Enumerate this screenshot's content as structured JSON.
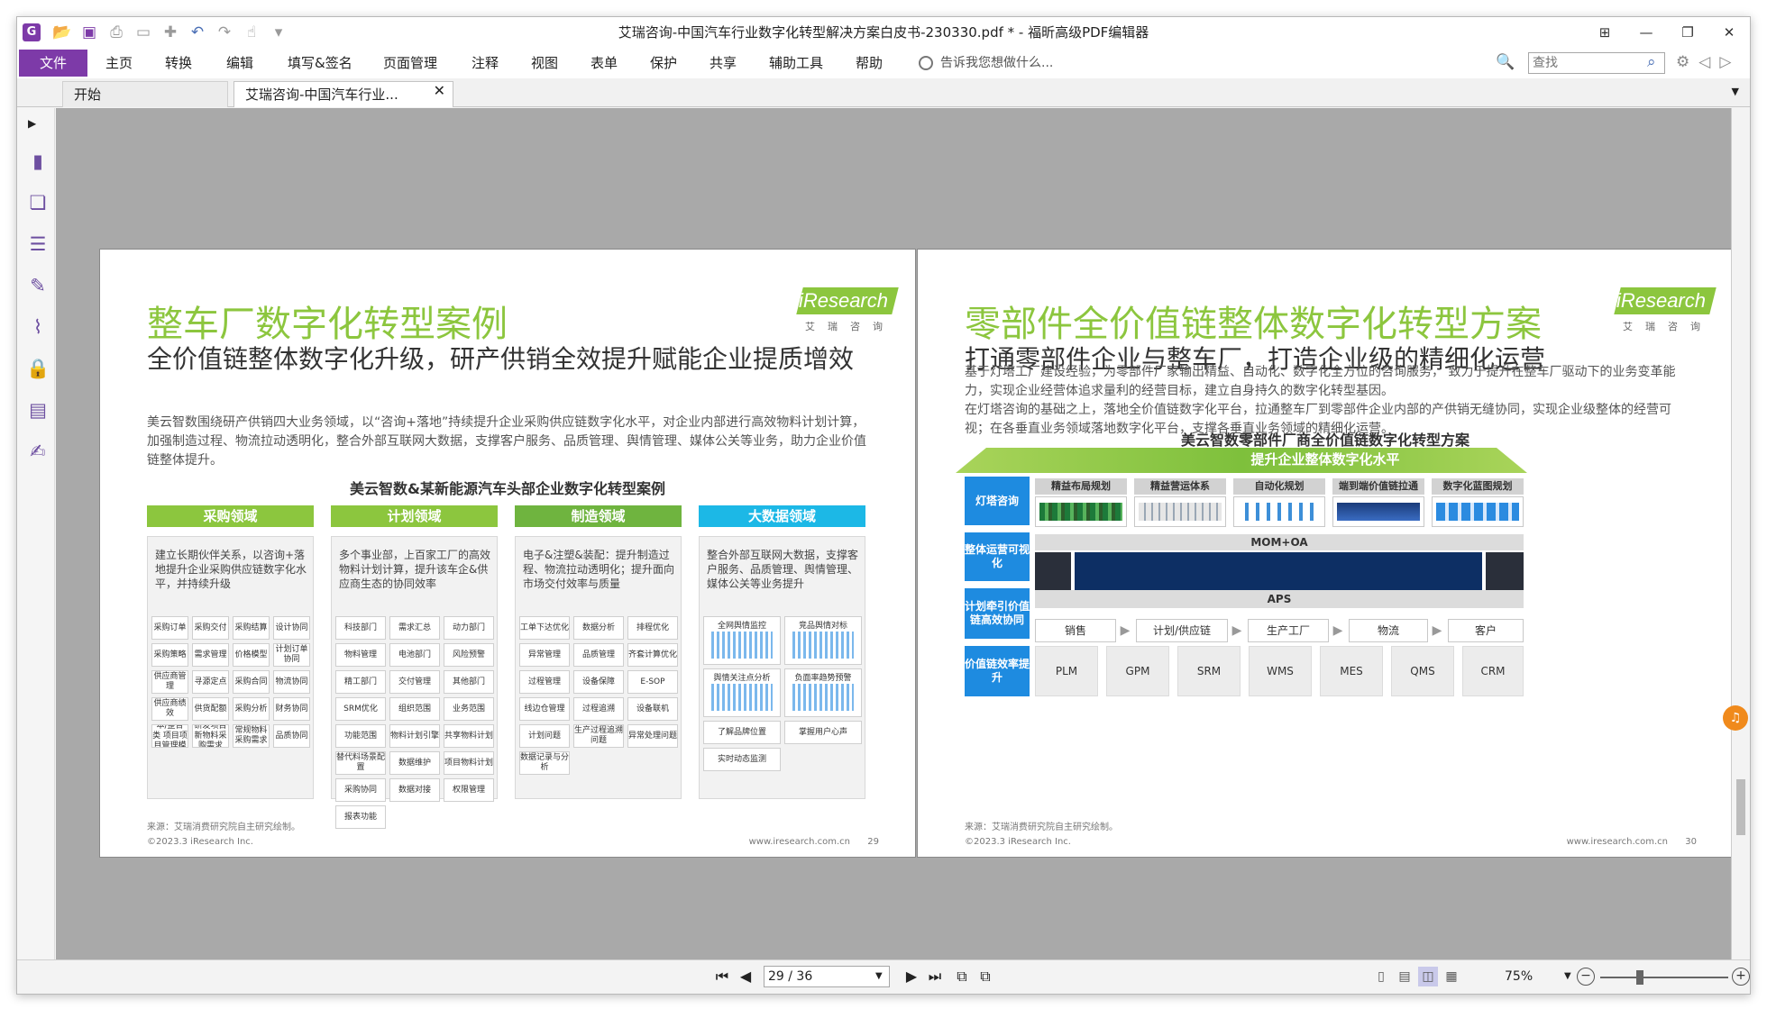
{
  "window": {
    "title": "艾瑞咨询-中国汽车行业数字化转型解决方案白皮书-230330.pdf * - 福昕高级PDF编辑器",
    "logo_letter": "G",
    "icons": [
      "app-logo-icon",
      "open-folder-icon",
      "save-icon",
      "print-icon",
      "scan-icon",
      "new-icon",
      "undo-icon",
      "redo-icon",
      "hand-tool-icon",
      "customize-icon"
    ],
    "controls": [
      "restore-layout-icon",
      "minimize-icon",
      "maximize-icon",
      "close-icon"
    ]
  },
  "menu": {
    "file": "文件",
    "items": [
      "主页",
      "转换",
      "编辑",
      "填写&签名",
      "页面管理",
      "注释",
      "视图",
      "表单",
      "保护",
      "共享",
      "辅助工具",
      "帮助"
    ],
    "tell_me": "告诉我您想做什么...",
    "search_placeholder": "查找"
  },
  "tabs": [
    {
      "label": "开始"
    },
    {
      "label": "艾瑞咨询-中国汽车行业..."
    }
  ],
  "sidebar_icons": [
    "bookmark-icon",
    "pages-icon",
    "layers-icon",
    "comments-icon",
    "attachments-icon",
    "security-icon",
    "form-fields-icon",
    "signature-icon"
  ],
  "left_page": {
    "title": "整车厂数字化转型案例",
    "brand": "iResearch",
    "brand_cn": "艾瑞咨询",
    "subtitle": "全价值链整体数字化升级，研产供销全效提升赋能企业提质增效",
    "body": "美云智数围绕研产供销四大业务领域，以“咨询+落地”持续提升企业采购供应链数字化水平，对企业内部进行高效物料计划计算，加强制造过程、物流拉动透明化，整合外部互联网大数据，支撑客户服务、品质管理、舆情管理、媒体公关等业务，助力企业价值链整体提升。",
    "chart_title": "美云智数&某新能源汽车头部企业数字化转型案例",
    "source": "来源：艾瑞消费研究院自主研究绘制。",
    "copyright": "©2023.3 iResearch Inc.",
    "url": "www.iresearch.com.cn",
    "page_num": "29",
    "columns": [
      {
        "head": "采购领域",
        "color": "#8cc63e",
        "desc": "建立长期伙伴关系，以咨询+落地提升企业采购供应链数字化水平，并持续升级",
        "cells": [
          "采购订单",
          "采购交付",
          "采购结算",
          "设计协同",
          "采购策略",
          "需求管理",
          "价格模型",
          "计划订单协同",
          "供应商管理",
          "寻源定点",
          "采购合同",
          "物流协同",
          "供应商绩效",
          "供货配额",
          "采购分析",
          "财务协同",
          "研发/降本/整合类 项目项目管理模型",
          "研发项目新物料采购需求",
          "常规物料采购需求",
          "品质协同"
        ]
      },
      {
        "head": "计划领域",
        "color": "#8cc63e",
        "desc": "多个事业部，上百家工厂的高效物料计划计算，提升该车企&供应商生态的协同效率",
        "cells": [
          "科技部门",
          "需求汇总",
          "动力部门",
          "物料管理",
          "电池部门",
          "风险预警",
          "精工部门",
          "交付管理",
          "其他部门",
          "SRM优化",
          "组织范围",
          "业务范围",
          "功能范围",
          "物料计划引擎",
          "共享物料计划",
          "替代料场景配置",
          "数据维护",
          "项目物料计划",
          "采购协同",
          "数据对接",
          "权限管理",
          "报表功能"
        ]
      },
      {
        "head": "制造领域",
        "color": "#6fb43f",
        "desc": "电子&注塑&装配：提升制造过程、物流拉动透明化；提升面向市场交付效率与质量",
        "cells": [
          "工单下达优化",
          "数据分析",
          "排程优化",
          "异常管理",
          "品质管理",
          "齐套计算优化",
          "过程管理",
          "设备保障",
          "E-SOP",
          "线边仓管理",
          "过程追溯",
          "设备联机",
          "计划问题",
          "生产过程追溯问题",
          "异常处理问题",
          "数据记录与分析"
        ]
      },
      {
        "head": "大数据领域",
        "color": "#1cb8e6",
        "desc": "整合外部互联网大数据，支撑客户服务、品质管理、舆情管理、媒体公关等业务提升",
        "cells": [
          "全网舆情监控",
          "竞品舆情对标",
          "舆情关注点分析",
          "负面率趋势预警",
          "了解品牌位置",
          "掌握用户心声",
          "实时动态监测"
        ]
      }
    ]
  },
  "right_page": {
    "title": "零部件全价值链整体数字化转型方案",
    "brand": "iResearch",
    "brand_cn": "艾瑞咨询",
    "subtitle": "打通零部件企业与整车厂，打造企业级的精细化运营",
    "body1": "基于灯塔工厂建设经验，为零部件厂家输出精益、自动化、数字化全方位的咨询服务， 致力于提升在整车厂驱动下的业务变革能力，实现企业经营体追求量利的经营目标，建立自身持久的数字化转型基因。",
    "body2": "在灯塔咨询的基础之上，落地全价值链数字化平台，拉通整车厂到零部件企业内部的产供销无缝协同，实现企业级整体的经营可视；在各垂直业务领域落地数字化平台，支撑各垂直业务领域的精细化运营。",
    "chart_title": "美云智数零部件厂商全价值链数字化转型方案",
    "banner": "提升企业整体数字化水平",
    "rows": [
      "灯塔咨询",
      "整体运营可视化",
      "计划牵引价值链高效协同",
      "价值链效率提升"
    ],
    "consulting": [
      "精益布局规划",
      "精益营运体系",
      "自动化规划",
      "端到端价值链拉通",
      "数字化蓝图规划"
    ],
    "mom": "MOM+OA",
    "aps": "APS",
    "flow": [
      "销售",
      "计划/供应链",
      "生产工厂",
      "物流",
      "客户"
    ],
    "systems": [
      "PLM",
      "GPM",
      "SRM",
      "WMS",
      "MES",
      "QMS",
      "CRM"
    ],
    "source": "来源：艾瑞消费研究院自主研究绘制。",
    "copyright": "©2023.3 iResearch Inc.",
    "url": "www.iresearch.com.cn",
    "page_num": "30"
  },
  "status": {
    "page_indicator": "29 / 36",
    "zoom": "75%"
  },
  "colors": {
    "accent": "#7d3aa8",
    "brand_green": "#8cc63e",
    "diagram_blue": "#1e8be0"
  }
}
